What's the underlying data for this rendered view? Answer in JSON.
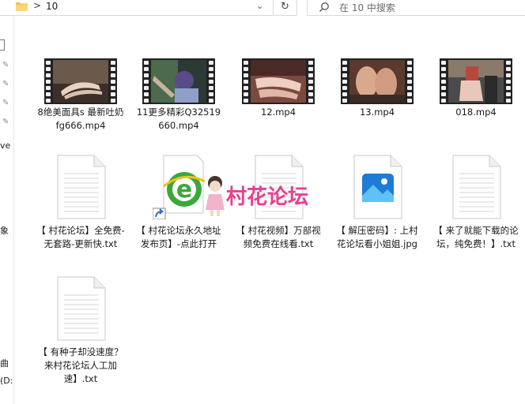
{
  "address_bar": {
    "separator": ">",
    "path": "10",
    "dropdown": "⌄",
    "refresh": "↻"
  },
  "search": {
    "placeholder": "在 10 中搜索"
  },
  "nav_pane": {
    "texts": [
      "ve -",
      "象",
      "曲",
      "(D:"
    ]
  },
  "files": [
    {
      "name": "8绝美面具s 最新吐奶fg666.mp4",
      "type": "video",
      "icon": "video-thumbnail"
    },
    {
      "name": "11更多精彩Q32519660.mp4",
      "type": "video",
      "icon": "video-thumbnail"
    },
    {
      "name": "12.mp4",
      "type": "video",
      "icon": "video-thumbnail"
    },
    {
      "name": "13.mp4",
      "type": "video",
      "icon": "video-thumbnail"
    },
    {
      "name": "018.mp4",
      "type": "video",
      "icon": "video-thumbnail"
    },
    {
      "name": "【 村花论坛】全免费-无套路-更新快.txt",
      "type": "text",
      "icon": "text-file-icon"
    },
    {
      "name": "【 村花论坛永久地址发布页】-点此打开",
      "type": "shortcut",
      "icon": "browser-shortcut-icon"
    },
    {
      "name": "【 村花视频】万部视频免费在线看.txt",
      "type": "text",
      "icon": "text-file-icon"
    },
    {
      "name": "【 解压密码】: 上村花论坛看小姐姐.jpg",
      "type": "image",
      "icon": "image-file-icon"
    },
    {
      "name": "【 来了就能下载的论坛，纯免费！】.txt",
      "type": "text",
      "icon": "text-file-icon"
    },
    {
      "name": "【 有种子却没速度？来村花论坛人工加速】.txt",
      "type": "text",
      "icon": "text-file-icon"
    }
  ],
  "watermark": {
    "logo_text": "村花论坛"
  },
  "colors": {
    "accent_blue": "#1e7bd6",
    "watermark_pink": "#e6408f",
    "browser_green": "#3aa83a",
    "folder_yellow": "#f3c542"
  }
}
